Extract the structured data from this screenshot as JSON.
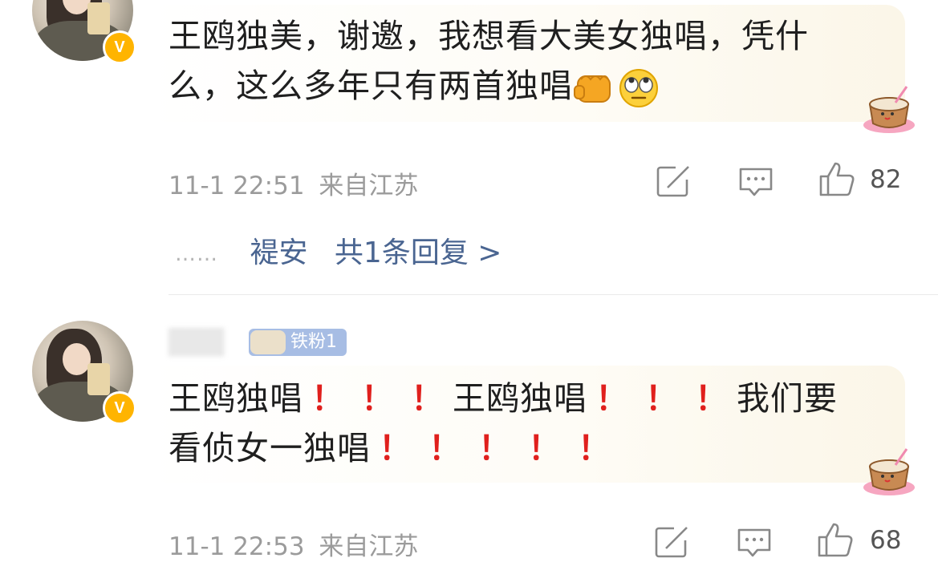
{
  "comments": [
    {
      "text_line1": "王鸥独美，谢邀，我想看大美女独唱，凭什",
      "text_line2": "么，这么多年只有两首独唱",
      "time": "11-1 22:51",
      "location": "来自江苏",
      "likes": "82",
      "reply_author": "褆安",
      "reply_link": "共1条回复 >",
      "dots": "……",
      "verified_badge": "V"
    },
    {
      "fan_badge": "铁粉1",
      "text_part1": "王鸥独唱",
      "text_part2": "王鸥独唱",
      "text_part3": "我们要",
      "text_line2": "看侦女一独唱",
      "exclaim": "！",
      "time": "11-1 22:53",
      "location": "来自江苏",
      "likes": "68",
      "verified_badge": "V"
    }
  ],
  "icons": {
    "verified": "verified-badge-icon",
    "edit": "edit-icon",
    "comment": "comment-icon",
    "like": "thumbs-up-icon",
    "fist": "fist-emoji-icon",
    "eye_roll": "eye-roll-emoji-icon",
    "decoration": "coconut-drink-sticker-icon"
  },
  "colors": {
    "link": "#4a6591",
    "meta": "#9b9b9b",
    "exclaim": "#e0201d",
    "verified": "#ffb400",
    "fan_badge": "#a7bde4"
  }
}
